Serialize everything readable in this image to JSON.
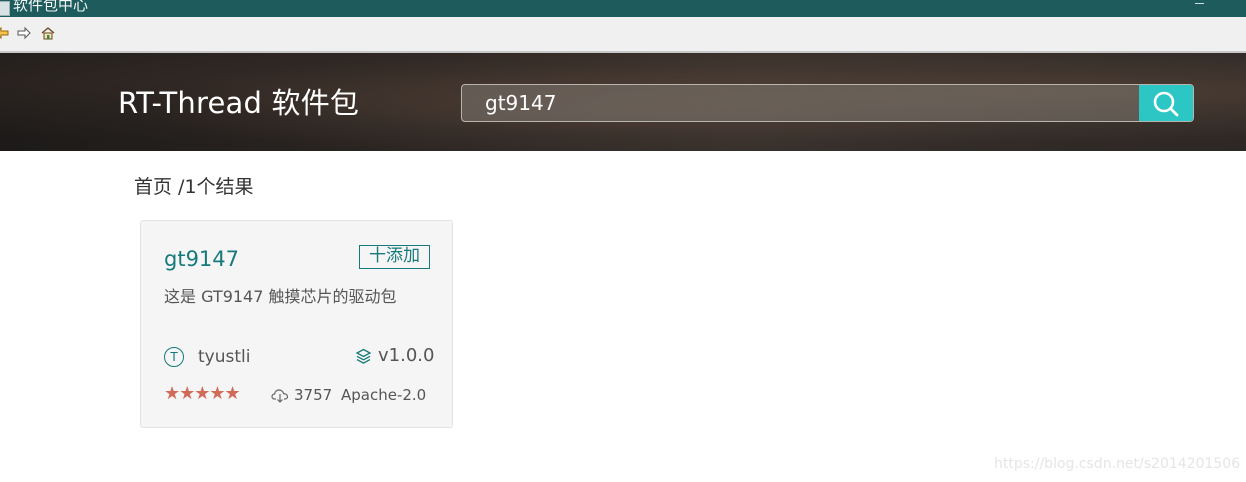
{
  "window": {
    "title": "软件包中心"
  },
  "toolbar": {
    "icons": [
      "back-arrow-icon",
      "forward-arrow-icon",
      "home-icon"
    ]
  },
  "header": {
    "brand": "RT-Thread 软件包",
    "search_value": "gt9147",
    "search_icon": "search-icon"
  },
  "breadcrumb": {
    "home": "首页",
    "separator": " /",
    "result_count": "1个结果"
  },
  "results": [
    {
      "name": "gt9147",
      "add_label": "十添加",
      "description": "这是 GT9147 触摸芯片的驱动包",
      "author_initial": "T",
      "author": "tyustli",
      "version": "v1.0.0",
      "rating_stars": "★★★★★",
      "rating": 5,
      "downloads": "3757",
      "license": "Apache-2.0"
    }
  ],
  "watermark": "https://blog.csdn.net/s2014201506",
  "colors": {
    "accent": "#167a7c",
    "search_button": "#2cc6c5",
    "title_bar": "#1e5b5c",
    "stars": "#cf6b58"
  }
}
